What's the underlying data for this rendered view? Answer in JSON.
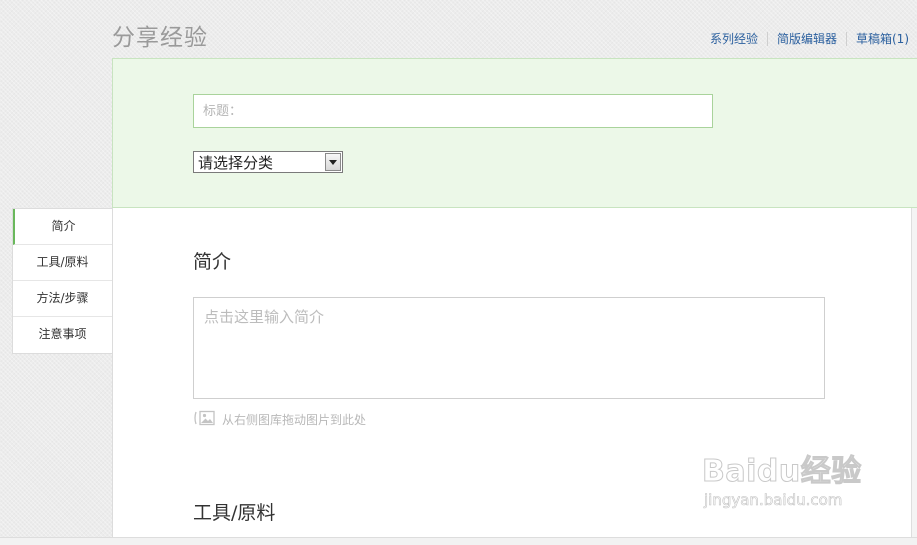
{
  "header": {
    "title": "分享经验",
    "links": [
      "系列经验",
      "简版编辑器",
      "草稿箱(1)"
    ]
  },
  "form": {
    "title_placeholder": "标题：",
    "category_selected": "请选择分类"
  },
  "side_nav": {
    "items": [
      {
        "label": "简介",
        "active": true
      },
      {
        "label": "工具/原料",
        "active": false
      },
      {
        "label": "方法/步骤",
        "active": false
      },
      {
        "label": "注意事项",
        "active": false
      }
    ]
  },
  "intro": {
    "heading": "简介",
    "placeholder": "点击这里输入简介",
    "drag_hint": "从右侧图库拖动图片到此处"
  },
  "tools": {
    "heading": "工具/原料"
  },
  "watermark": {
    "logo_text": "Baidu经验",
    "url": "jingyan.baidu.com"
  },
  "colors": {
    "accent_green": "#6ab85c",
    "panel_green": "#ecf8e8",
    "link_blue": "#2a5f9e"
  }
}
